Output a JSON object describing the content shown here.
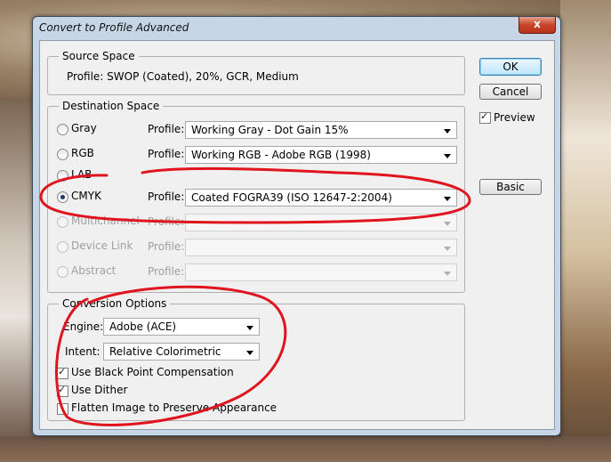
{
  "window": {
    "title": "Convert to Profile Advanced",
    "close_glyph": "x"
  },
  "source_space": {
    "label": "Source Space",
    "profile_text": "Profile:  SWOP (Coated), 20%, GCR, Medium"
  },
  "destination_space": {
    "label": "Destination Space",
    "profile_label": "Profile:",
    "rows": [
      {
        "mode": "Gray",
        "profile": "Working Gray - Dot Gain 15%",
        "checked": false,
        "enabled": true
      },
      {
        "mode": "RGB",
        "profile": "Working RGB - Adobe RGB (1998)",
        "checked": false,
        "enabled": true
      },
      {
        "mode": "LAB",
        "profile": "",
        "checked": false,
        "enabled": true
      },
      {
        "mode": "CMYK",
        "profile": "Coated FOGRA39 (ISO 12647-2:2004)",
        "checked": true,
        "enabled": true
      },
      {
        "mode": "Multichannel",
        "profile": "",
        "checked": false,
        "enabled": false
      },
      {
        "mode": "Device Link",
        "profile": "",
        "checked": false,
        "enabled": false
      },
      {
        "mode": "Abstract",
        "profile": "",
        "checked": false,
        "enabled": false
      }
    ]
  },
  "conversion_options": {
    "label": "Conversion Options",
    "engine_label": "Engine:",
    "engine_value": "Adobe (ACE)",
    "intent_label": "Intent:",
    "intent_value": "Relative Colorimetric",
    "checkboxes": [
      {
        "label": "Use Black Point Compensation",
        "checked": true
      },
      {
        "label": "Use Dither",
        "checked": true
      },
      {
        "label": "Flatten Image to Preserve Appearance",
        "checked": false
      }
    ]
  },
  "buttons": {
    "ok": "OK",
    "cancel": "Cancel",
    "basic": "Basic"
  },
  "preview": {
    "label": "Preview",
    "checked": true
  },
  "colors": {
    "annotation": "#e0141e",
    "title_bar": "#c7d6e6",
    "dialog_bg": "#f0f0f0"
  }
}
